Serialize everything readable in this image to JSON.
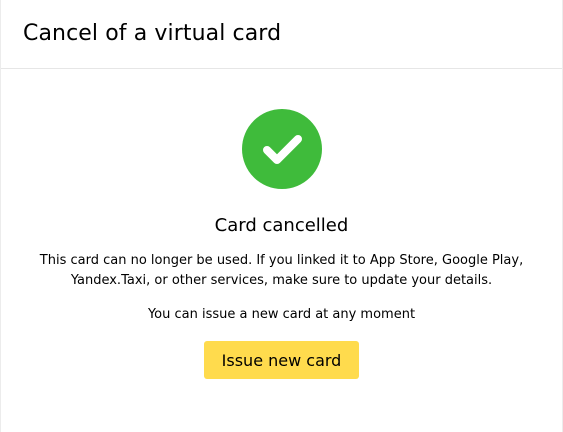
{
  "dialog": {
    "title": "Cancel of a virtual card"
  },
  "status": {
    "icon": "check-circle-icon",
    "icon_color": "#3fbb3b",
    "heading": "Card cancelled",
    "description_line1": "This card can no longer be used. If you linked it to App Store, Google Play,",
    "description_line2": "Yandex.Taxi, or other services, make sure to update your details.",
    "note": "You can issue a new card at any moment"
  },
  "actions": {
    "issue_label": "Issue new card",
    "button_color": "#ffdb4d"
  }
}
